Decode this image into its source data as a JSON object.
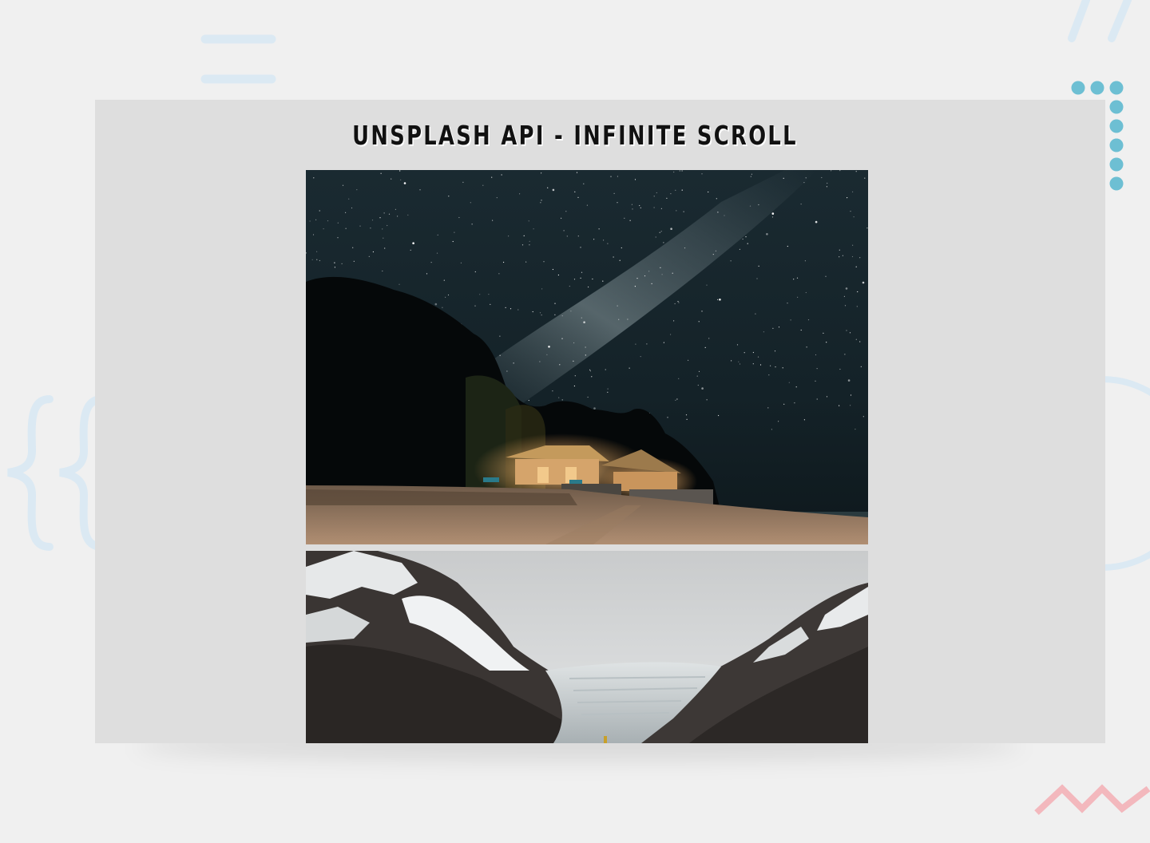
{
  "page": {
    "title": "UNSPLASH API - INFINITE SCROLL"
  },
  "images": [
    {
      "subject": "night beach bungalows under the milky way"
    },
    {
      "subject": "snowy mountain valley with glacier"
    }
  ],
  "colors": {
    "background": "#f0f0f0",
    "panel": "#dedede",
    "title_text": "#111111",
    "deco_blue": "#dbe9f3",
    "deco_dots": "#6dbfd3",
    "deco_zigzag": "#f3b8bd"
  }
}
